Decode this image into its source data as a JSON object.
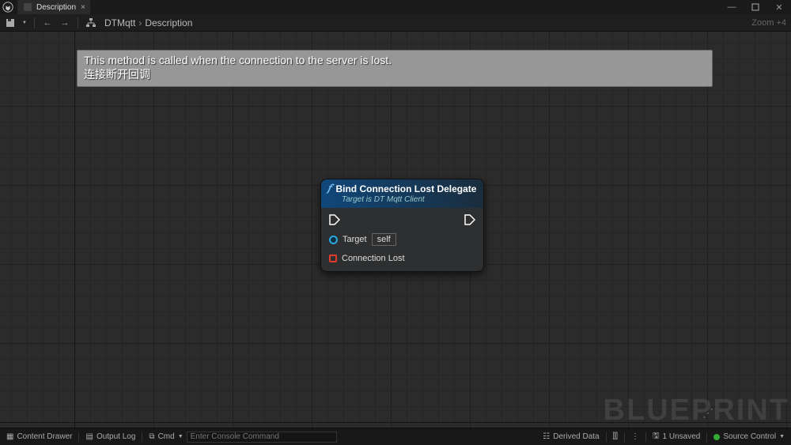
{
  "titlebar": {
    "tab_label": "Description"
  },
  "toolbar": {
    "breadcrumb": [
      "DTMqtt",
      "Description"
    ],
    "zoom": "Zoom +4"
  },
  "description": {
    "line1": "This method is called when the connection to the server is lost.",
    "line2": "连接断开回调"
  },
  "node": {
    "title": "Bind Connection Lost Delegate",
    "subtitle": "Target is DT Mqtt Client",
    "pins": {
      "target_label": "Target",
      "target_value": "self",
      "delegate_label": "Connection Lost"
    }
  },
  "statusbar": {
    "content_drawer": "Content Drawer",
    "output_log": "Output Log",
    "cmd_label": "Cmd",
    "cmd_placeholder": "Enter Console Command",
    "derived_data": "Derived Data",
    "unsaved": "1 Unsaved",
    "source_control": "Source Control"
  },
  "watermark": "BLUEPRINT"
}
